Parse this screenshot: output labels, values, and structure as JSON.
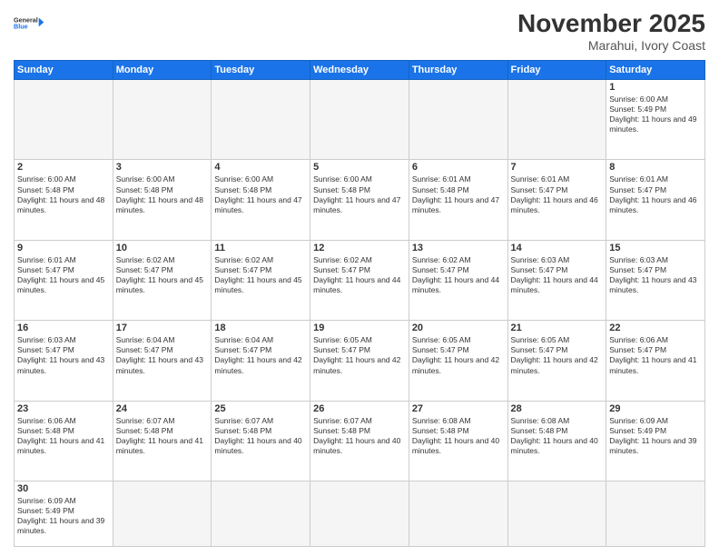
{
  "logo": {
    "line1": "General",
    "line2": "Blue"
  },
  "header": {
    "title": "November 2025",
    "location": "Marahui, Ivory Coast"
  },
  "weekdays": [
    "Sunday",
    "Monday",
    "Tuesday",
    "Wednesday",
    "Thursday",
    "Friday",
    "Saturday"
  ],
  "weeks": [
    [
      {
        "day": "",
        "empty": true
      },
      {
        "day": "",
        "empty": true
      },
      {
        "day": "",
        "empty": true
      },
      {
        "day": "",
        "empty": true
      },
      {
        "day": "",
        "empty": true
      },
      {
        "day": "",
        "empty": true
      },
      {
        "day": "1",
        "sunrise": "6:00 AM",
        "sunset": "5:49 PM",
        "daylight": "11 hours and 49 minutes."
      }
    ],
    [
      {
        "day": "2",
        "sunrise": "6:00 AM",
        "sunset": "5:48 PM",
        "daylight": "11 hours and 48 minutes."
      },
      {
        "day": "3",
        "sunrise": "6:00 AM",
        "sunset": "5:48 PM",
        "daylight": "11 hours and 48 minutes."
      },
      {
        "day": "4",
        "sunrise": "6:00 AM",
        "sunset": "5:48 PM",
        "daylight": "11 hours and 47 minutes."
      },
      {
        "day": "5",
        "sunrise": "6:00 AM",
        "sunset": "5:48 PM",
        "daylight": "11 hours and 47 minutes."
      },
      {
        "day": "6",
        "sunrise": "6:01 AM",
        "sunset": "5:48 PM",
        "daylight": "11 hours and 47 minutes."
      },
      {
        "day": "7",
        "sunrise": "6:01 AM",
        "sunset": "5:47 PM",
        "daylight": "11 hours and 46 minutes."
      },
      {
        "day": "8",
        "sunrise": "6:01 AM",
        "sunset": "5:47 PM",
        "daylight": "11 hours and 46 minutes."
      }
    ],
    [
      {
        "day": "9",
        "sunrise": "6:01 AM",
        "sunset": "5:47 PM",
        "daylight": "11 hours and 45 minutes."
      },
      {
        "day": "10",
        "sunrise": "6:02 AM",
        "sunset": "5:47 PM",
        "daylight": "11 hours and 45 minutes."
      },
      {
        "day": "11",
        "sunrise": "6:02 AM",
        "sunset": "5:47 PM",
        "daylight": "11 hours and 45 minutes."
      },
      {
        "day": "12",
        "sunrise": "6:02 AM",
        "sunset": "5:47 PM",
        "daylight": "11 hours and 44 minutes."
      },
      {
        "day": "13",
        "sunrise": "6:02 AM",
        "sunset": "5:47 PM",
        "daylight": "11 hours and 44 minutes."
      },
      {
        "day": "14",
        "sunrise": "6:03 AM",
        "sunset": "5:47 PM",
        "daylight": "11 hours and 44 minutes."
      },
      {
        "day": "15",
        "sunrise": "6:03 AM",
        "sunset": "5:47 PM",
        "daylight": "11 hours and 43 minutes."
      }
    ],
    [
      {
        "day": "16",
        "sunrise": "6:03 AM",
        "sunset": "5:47 PM",
        "daylight": "11 hours and 43 minutes."
      },
      {
        "day": "17",
        "sunrise": "6:04 AM",
        "sunset": "5:47 PM",
        "daylight": "11 hours and 43 minutes."
      },
      {
        "day": "18",
        "sunrise": "6:04 AM",
        "sunset": "5:47 PM",
        "daylight": "11 hours and 42 minutes."
      },
      {
        "day": "19",
        "sunrise": "6:05 AM",
        "sunset": "5:47 PM",
        "daylight": "11 hours and 42 minutes."
      },
      {
        "day": "20",
        "sunrise": "6:05 AM",
        "sunset": "5:47 PM",
        "daylight": "11 hours and 42 minutes."
      },
      {
        "day": "21",
        "sunrise": "6:05 AM",
        "sunset": "5:47 PM",
        "daylight": "11 hours and 42 minutes."
      },
      {
        "day": "22",
        "sunrise": "6:06 AM",
        "sunset": "5:47 PM",
        "daylight": "11 hours and 41 minutes."
      }
    ],
    [
      {
        "day": "23",
        "sunrise": "6:06 AM",
        "sunset": "5:48 PM",
        "daylight": "11 hours and 41 minutes."
      },
      {
        "day": "24",
        "sunrise": "6:07 AM",
        "sunset": "5:48 PM",
        "daylight": "11 hours and 41 minutes."
      },
      {
        "day": "25",
        "sunrise": "6:07 AM",
        "sunset": "5:48 PM",
        "daylight": "11 hours and 40 minutes."
      },
      {
        "day": "26",
        "sunrise": "6:07 AM",
        "sunset": "5:48 PM",
        "daylight": "11 hours and 40 minutes."
      },
      {
        "day": "27",
        "sunrise": "6:08 AM",
        "sunset": "5:48 PM",
        "daylight": "11 hours and 40 minutes."
      },
      {
        "day": "28",
        "sunrise": "6:08 AM",
        "sunset": "5:48 PM",
        "daylight": "11 hours and 40 minutes."
      },
      {
        "day": "29",
        "sunrise": "6:09 AM",
        "sunset": "5:49 PM",
        "daylight": "11 hours and 39 minutes."
      }
    ],
    [
      {
        "day": "30",
        "sunrise": "6:09 AM",
        "sunset": "5:49 PM",
        "daylight": "11 hours and 39 minutes."
      },
      {
        "day": "",
        "empty": true
      },
      {
        "day": "",
        "empty": true
      },
      {
        "day": "",
        "empty": true
      },
      {
        "day": "",
        "empty": true
      },
      {
        "day": "",
        "empty": true
      },
      {
        "day": "",
        "empty": true
      }
    ]
  ],
  "labels": {
    "sunrise_prefix": "Sunrise: ",
    "sunset_prefix": "Sunset: ",
    "daylight_prefix": "Daylight: "
  }
}
